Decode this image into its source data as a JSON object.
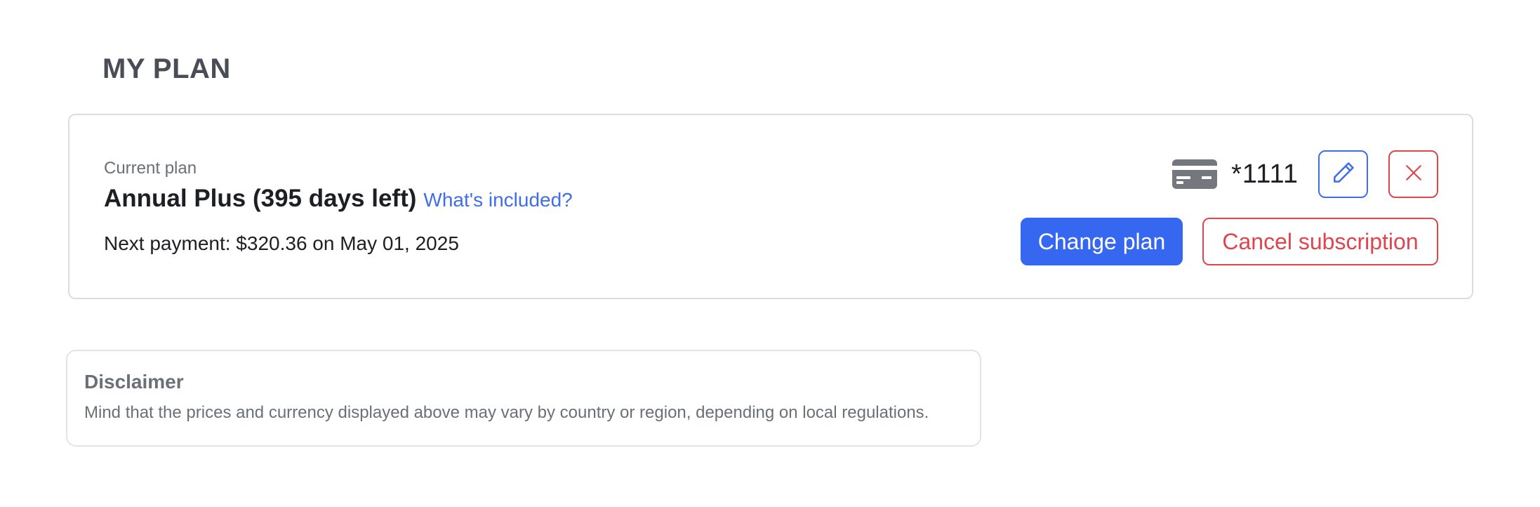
{
  "page": {
    "title": "MY PLAN"
  },
  "plan": {
    "current_label": "Current plan",
    "name": "Annual Plus (395 days left)",
    "included_link": "What's included?",
    "next_payment": "Next payment: $320.36 on May 01, 2025",
    "card_number": "*1111",
    "change_plan_label": "Change plan",
    "cancel_label": "Cancel subscription"
  },
  "disclaimer": {
    "title": "Disclaimer",
    "text": "Mind that the prices and currency displayed above may vary by country or region, depending on local regulations."
  },
  "icons": {
    "card": "credit-card-icon",
    "edit": "pencil-icon",
    "remove": "close-icon"
  },
  "colors": {
    "primary": "#3567f0",
    "link": "#3f6ee8",
    "danger": "#e0454e",
    "muted_text": "#6b6f78",
    "heading": "#4a4d55",
    "border": "#dcdde1"
  }
}
